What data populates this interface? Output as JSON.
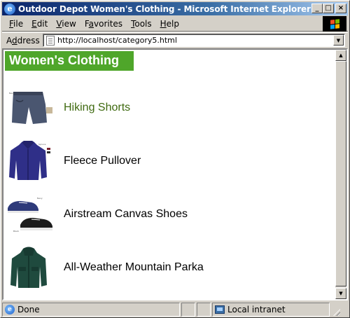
{
  "window": {
    "title": "Outdoor Depot Women's Clothing - Microsoft Internet Explorer",
    "buttons": {
      "minimize": "_",
      "maximize": "□",
      "close": "×"
    }
  },
  "menu": {
    "items": [
      {
        "label": "File",
        "accel": "F",
        "rest": "ile"
      },
      {
        "label": "Edit",
        "accel": "E",
        "rest": "dit"
      },
      {
        "label": "View",
        "accel": "V",
        "rest": "iew"
      },
      {
        "label": "Favorites",
        "accel": "a",
        "pre": "F",
        "rest": "vorites"
      },
      {
        "label": "Tools",
        "accel": "T",
        "rest": "ools"
      },
      {
        "label": "Help",
        "accel": "H",
        "rest": "elp"
      }
    ]
  },
  "address": {
    "label_pre": "A",
    "label_accel": "d",
    "label_rest": "dress",
    "url": "http://localhost/category5.html"
  },
  "page": {
    "heading": "Women's Clothing",
    "products": [
      {
        "name": "Hiking Shorts",
        "visited_link": true,
        "image": "hiking-shorts-image"
      },
      {
        "name": "Fleece Pullover",
        "visited_link": false,
        "image": "fleece-pullover-image"
      },
      {
        "name": "Airstream Canvas Shoes",
        "visited_link": false,
        "image": "canvas-shoes-image"
      },
      {
        "name": "All-Weather Mountain Parka",
        "visited_link": false,
        "image": "mountain-parka-image"
      }
    ],
    "header_color": "#4fa62a",
    "link_color": "#3f6a10"
  },
  "status": {
    "text": "Done",
    "zone": "Local intranet"
  }
}
